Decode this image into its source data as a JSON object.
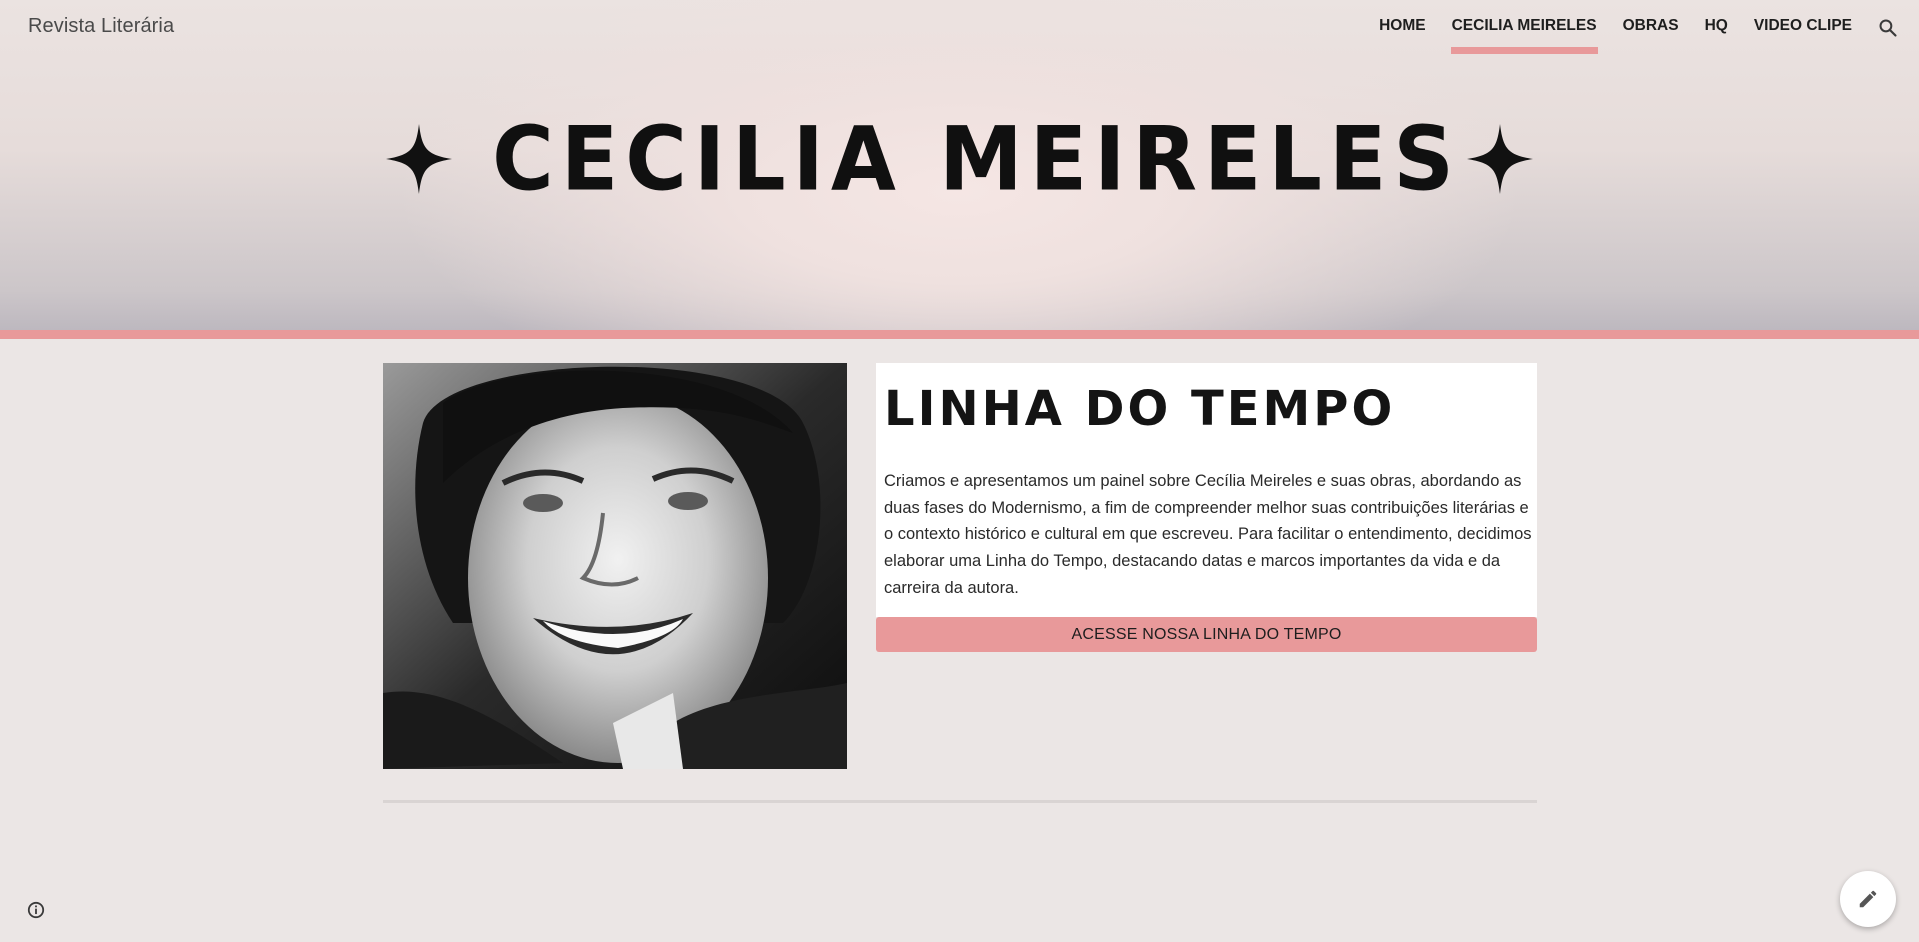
{
  "header": {
    "site_title": "Revista Literária",
    "nav": [
      {
        "label": "HOME",
        "active": false
      },
      {
        "label": "CECILIA MEIRELES",
        "active": true
      },
      {
        "label": "OBRAS",
        "active": false
      },
      {
        "label": "HQ",
        "active": false
      },
      {
        "label": "VIDEO CLIPE",
        "active": false
      }
    ],
    "search_icon": "search-icon"
  },
  "hero": {
    "title": "CECILIA MEIRELES",
    "decoration_icon": "four-point-star-icon"
  },
  "main": {
    "photo_alt": "Cecilia Meireles",
    "heading": "LINHA DO TEMPO",
    "body": " Criamos e apresentamos um painel sobre Cecília Meireles e suas obras, abordando as duas fases do Modernismo, a fim de compreender melhor suas contribuições literárias e o contexto histórico e cultural em que escreveu. Para facilitar o entendimento, decidimos elaborar uma Linha do Tempo, destacando datas e marcos importantes da vida e da carreira da autora.",
    "cta_label": "ACESSE NOSSA LINHA DO TEMPO"
  },
  "footer": {
    "info_icon": "info-icon",
    "edit_icon": "pencil-icon"
  },
  "colors": {
    "accent": "#e8999a",
    "page_background": "#ebe6e5"
  }
}
